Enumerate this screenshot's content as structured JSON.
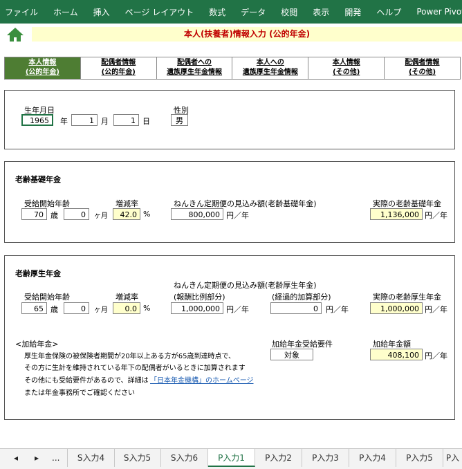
{
  "ribbon": [
    "ファイル",
    "ホーム",
    "挿入",
    "ページ レイアウト",
    "数式",
    "データ",
    "校閲",
    "表示",
    "開発",
    "ヘルプ",
    "Power Pivot"
  ],
  "title": "本人(扶養者)情報入力 (公的年金)",
  "tabs": [
    {
      "l1": "本人情報",
      "l2": "(公的年金)"
    },
    {
      "l1": "配偶者情報",
      "l2": "(公的年金)"
    },
    {
      "l1": "配偶者への",
      "l2": "遺族厚生年金情報"
    },
    {
      "l1": "本人への",
      "l2": "遺族厚生年金情報"
    },
    {
      "l1": "本人情報",
      "l2": "(その他)"
    },
    {
      "l1": "配偶者情報",
      "l2": "(その他)"
    }
  ],
  "birth": {
    "label": "生年月日",
    "year": "1965",
    "year_unit": "年",
    "month": "1",
    "month_unit": "月",
    "day": "1",
    "day_unit": "日",
    "gender_label": "性別",
    "gender": "男"
  },
  "kiso": {
    "heading": "老齢基礎年金",
    "start_age_label": "受給開始年齢",
    "age": "70",
    "age_unit": "歳",
    "months": "0",
    "months_unit": "ヶ月",
    "rate_label": "増減率",
    "rate": "42.0",
    "rate_unit": "%",
    "expected_label": "ねんきん定期便の見込み額(老齢基礎年金)",
    "expected": "800,000",
    "expected_unit": "円／年",
    "actual_label": "実際の老齢基礎年金",
    "actual": "1,136,000",
    "actual_unit": "円／年"
  },
  "kosei": {
    "heading": "老齢厚生年金",
    "start_age_label": "受給開始年齢",
    "age": "65",
    "age_unit": "歳",
    "months": "0",
    "months_unit": "ヶ月",
    "rate_label": "増減率",
    "rate": "0.0",
    "rate_unit": "%",
    "expected_label": "ねんきん定期便の見込み額(老齢厚生年金)",
    "hirei_label": "(報酬比例部分)",
    "hirei": "1,000,000",
    "hirei_unit": "円／年",
    "keika_label": "(経過的加算部分)",
    "keika": "0",
    "keika_unit": "円／年",
    "actual_label": "実際の老齢厚生年金",
    "actual": "1,000,000",
    "actual_unit": "円／年",
    "kakyu_heading": "<加給年金>",
    "kakyu_line1": "厚生年金保険の被保険者期間が20年以上ある方が65歳到達時点で、",
    "kakyu_line2": "その方に生計を維持されている年下の配偶者がいるときに加算されます",
    "kakyu_line3": "その他にも受給要件があるので、詳細は",
    "kakyu_link": "「日本年金機構」のホームページ",
    "kakyu_line4": "または年金事務所でご確認ください",
    "req_label": "加給年金受給要件",
    "req": "対象",
    "amount_label": "加給年金額",
    "amount": "408,100",
    "amount_unit": "円／年"
  },
  "sheets": {
    "nav_prev": "◂",
    "nav_next": "▸",
    "more": "...",
    "tabs": [
      "S入力4",
      "S入力5",
      "S入力6",
      "P入力1",
      "P入力2",
      "P入力3",
      "P入力4",
      "P入力5",
      "P入"
    ],
    "active": "P入力1"
  }
}
